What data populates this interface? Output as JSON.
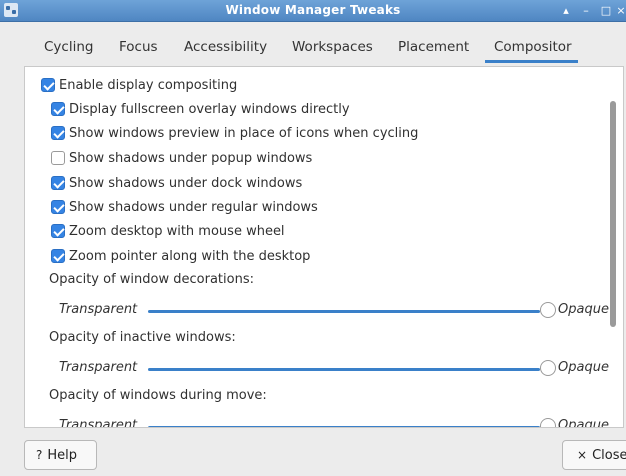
{
  "window": {
    "title": "Window Manager Tweaks"
  },
  "tabs": [
    {
      "label": "Cycling"
    },
    {
      "label": "Focus"
    },
    {
      "label": "Accessibility"
    },
    {
      "label": "Workspaces"
    },
    {
      "label": "Placement"
    },
    {
      "label": "Compositor"
    }
  ],
  "active_tab": "Compositor",
  "compositor": {
    "enable": {
      "label": "Enable display compositing",
      "checked": true
    },
    "options": [
      {
        "label": "Display fullscreen overlay windows directly",
        "checked": true
      },
      {
        "label": "Show windows preview in place of icons when cycling",
        "checked": true
      },
      {
        "label": "Show shadows under popup windows",
        "checked": false
      },
      {
        "label": "Show shadows under dock windows",
        "checked": true
      },
      {
        "label": "Show shadows under regular windows",
        "checked": true
      },
      {
        "label": "Zoom desktop with mouse wheel",
        "checked": true
      },
      {
        "label": "Zoom pointer along with the desktop",
        "checked": true
      }
    ],
    "sliders": [
      {
        "heading": "Opacity of window decorations:",
        "left": "Transparent",
        "right": "Opaque",
        "value": 1.0
      },
      {
        "heading": "Opacity of inactive windows:",
        "left": "Transparent",
        "right": "Opaque",
        "value": 1.0
      },
      {
        "heading": "Opacity of windows during move:",
        "left": "Transparent",
        "right": "Opaque",
        "value": 1.0
      }
    ]
  },
  "buttons": {
    "help": "Help",
    "close": "Close"
  },
  "icons": {
    "help": "?",
    "close": "×"
  },
  "colors": {
    "accent": "#3584e4",
    "titlebar": "#4f86c2"
  }
}
